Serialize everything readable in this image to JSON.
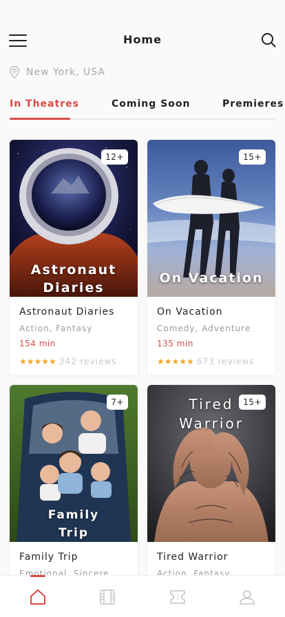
{
  "header": {
    "title": "Home",
    "menu_icon": "hamburger-menu-icon",
    "search_icon": "search-icon"
  },
  "location": {
    "icon": "location-pin-icon",
    "text": "New York, USA"
  },
  "tabs": [
    {
      "label": "In Theatres",
      "active": true
    },
    {
      "label": "Coming Soon",
      "active": false
    },
    {
      "label": "Premieres",
      "active": false
    }
  ],
  "movies": [
    {
      "name": "Astronaut Diaries",
      "poster_title": "Astronaut Diaries",
      "age": "12+",
      "genre": "Action, Fantasy",
      "duration": "154 min",
      "stars": "★★★★★",
      "reviews": "342 reviews"
    },
    {
      "name": "On Vacation",
      "poster_title": "On Vacation",
      "age": "15+",
      "genre": "Comedy, Adventure",
      "duration": "135 min",
      "stars": "★★★★★",
      "reviews": "673 reviews"
    },
    {
      "name": "Family Trip",
      "poster_title": "Family Trip",
      "age": "7+",
      "genre": "Emotional, Sincere"
    },
    {
      "name": "Tired Warrior",
      "poster_title": "Tired Warrior",
      "age": "15+",
      "genre": "Action, Fantasy"
    }
  ],
  "bottom_nav": [
    {
      "icon": "home-icon",
      "active": true
    },
    {
      "icon": "film-icon",
      "active": false
    },
    {
      "icon": "ticket-icon",
      "active": false
    },
    {
      "icon": "profile-icon",
      "active": false
    }
  ],
  "colors": {
    "accent": "#d94a44",
    "star": "#f5a623",
    "muted": "#9a9a9a"
  }
}
